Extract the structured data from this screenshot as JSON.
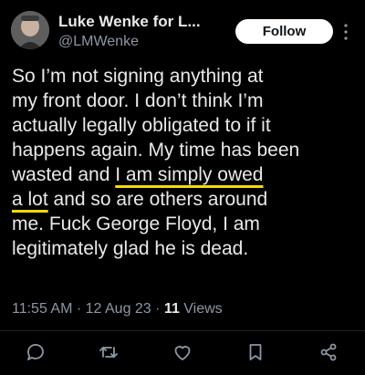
{
  "tweet": {
    "author_name": "Luke Wenke for L...",
    "author_handle": "@LMWenke",
    "follow_label": "Follow",
    "text_lines": [
      "So I’m not signing anything at",
      "my front door.  I don’t think I’m",
      "actually legally obligated to if it",
      "happens again.  My time has been"
    ],
    "line5_pre": "wasted and ",
    "line5_ul": "I am simply owed",
    "line6_ul": "a lot",
    "line6_post": " and so are others around",
    "line7": "me.  Fuck George Floyd, I am",
    "line8": "legitimately glad he is dead.",
    "timestamp": "11:55 AM · 12 Aug 23 · ",
    "views_count": "11",
    "views_label": " Views"
  },
  "colors": {
    "background": "#000000",
    "text": "#e7e9ea",
    "secondary": "#8b98a5",
    "underline": "#f5d90a"
  },
  "icons": {
    "reply": "reply-icon",
    "retweet": "retweet-icon",
    "like": "heart-icon",
    "bookmark": "bookmark-icon",
    "share": "share-icon",
    "more": "more-vertical-icon"
  }
}
